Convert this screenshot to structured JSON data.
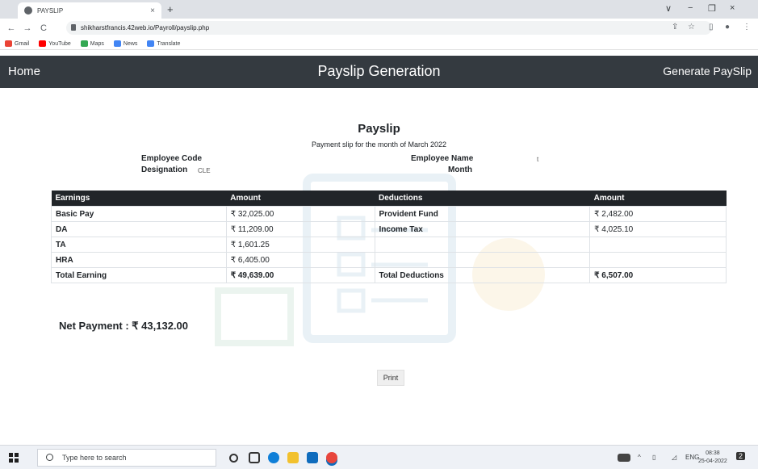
{
  "browser": {
    "tab_title": "PAYSLIP",
    "tab_close": "×",
    "new_tab": "+",
    "url": "shikharstfrancis.42web.io/Payroll/payslip.php",
    "back": "←",
    "forward": "→",
    "reload": "C",
    "controls": {
      "dropdown": "∨",
      "minimize": "−",
      "restore": "❐",
      "close": "×"
    },
    "bookmarks": [
      {
        "label": "Gmail",
        "color": "#ea4335"
      },
      {
        "label": "YouTube",
        "color": "#ff0000"
      },
      {
        "label": "Maps",
        "color": "#34a853"
      },
      {
        "label": "News",
        "color": "#4285f4"
      },
      {
        "label": "Translate",
        "color": "#4285f4"
      }
    ]
  },
  "navbar": {
    "home": "Home",
    "title": "Payslip Generation",
    "generate": "Generate PaySlip",
    "bg_color": "#343a40"
  },
  "payslip": {
    "title": "Payslip",
    "subtitle": "Payment slip for the month of March 2022",
    "employee_code_label": "Employee Code",
    "designation_label": "Designation",
    "designation_value": "CLE",
    "employee_name_label": "Employee Name",
    "employee_name_value": "t",
    "month_label": "Month"
  },
  "table": {
    "headers": [
      "Earnings",
      "Amount",
      "Deductions",
      "Amount"
    ],
    "rows": [
      [
        "Basic Pay",
        "₹ 32,025.00",
        "Provident Fund",
        "₹ 2,482.00"
      ],
      [
        "DA",
        "₹ 11,209.00",
        "Income Tax",
        "₹ 4,025.10"
      ],
      [
        "TA",
        "₹ 1,601.25",
        "",
        ""
      ],
      [
        "HRA",
        "₹ 6,405.00",
        "",
        ""
      ],
      [
        "Total Earning",
        "₹ 49,639.00",
        "Total Deductions",
        "₹ 6,507.00"
      ]
    ]
  },
  "net_payment": "Net Payment : ₹ 43,132.00",
  "print_label": "Print",
  "taskbar": {
    "search_placeholder": "Type here to search",
    "lang": "ENG",
    "time": "08:38",
    "date": "25-04-2022",
    "notification_count": "2"
  }
}
